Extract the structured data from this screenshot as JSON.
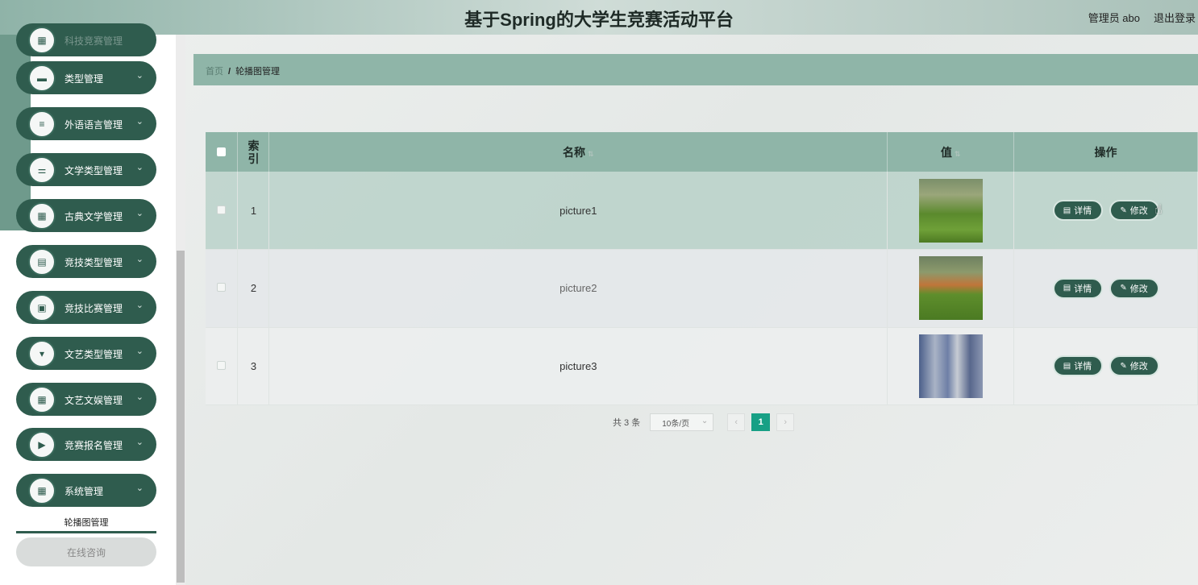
{
  "header": {
    "title": "基于Spring的大学生竞赛活动平台",
    "user": "管理员 abo",
    "logout": "退出登录"
  },
  "sidebar": {
    "items": [
      {
        "label": "科技竞赛管理",
        "icon": "grid-icon"
      },
      {
        "label": "类型管理",
        "icon": "chat-icon"
      },
      {
        "label": "外语语言管理",
        "icon": "menu-icon"
      },
      {
        "label": "文学类型管理",
        "icon": "sliders-icon"
      },
      {
        "label": "古典文学管理",
        "icon": "grid-icon"
      },
      {
        "label": "竞技类型管理",
        "icon": "clipboard-icon"
      },
      {
        "label": "竞技比赛管理",
        "icon": "clipboard-check-icon"
      },
      {
        "label": "文艺类型管理",
        "icon": "pin-icon"
      },
      {
        "label": "文艺文娱管理",
        "icon": "grid-icon"
      },
      {
        "label": "竞赛报名管理",
        "icon": "video-icon"
      },
      {
        "label": "系统管理",
        "icon": "grid-icon"
      }
    ],
    "submenu_active": "轮播图管理",
    "consult": "在线咨询"
  },
  "breadcrumb": {
    "home": "首页",
    "separator": "/",
    "current": "轮播图管理"
  },
  "table": {
    "headers": {
      "index": "索引",
      "name": "名称",
      "value": "值",
      "actions": "操作"
    },
    "rows": [
      {
        "index": "1",
        "name": "picture1"
      },
      {
        "index": "2",
        "name": "picture2"
      },
      {
        "index": "3",
        "name": "picture3"
      }
    ],
    "detail_label": "详情",
    "edit_label": "修改"
  },
  "pager": {
    "total": "共 3 条",
    "page_size": "10条/页",
    "current_page": "1"
  },
  "colors": {
    "primary": "#2f5c4e",
    "header_bg": "#8fb5a8",
    "page_active": "#17a085"
  }
}
